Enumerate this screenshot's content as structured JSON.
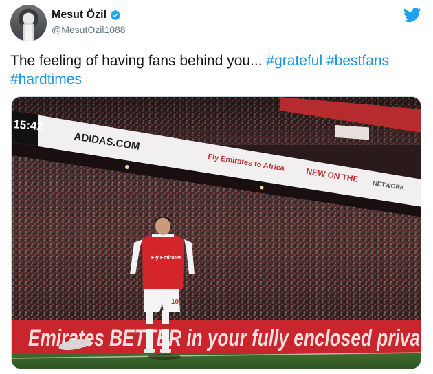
{
  "tweet": {
    "display_name": "Mesut Özil",
    "handle": "@MesutOzil1088",
    "text_main": "The feeling of having fans behind you... ",
    "hashtags": [
      "#grateful",
      "#bestfans",
      "#hardtimes"
    ]
  },
  "media": {
    "scoreboard_time": "15:42",
    "board_text_1": "ADIDAS.COM",
    "board_text_2": "Fly Emirates to Africa",
    "board_text_3": "NEW ON THE",
    "board_text_4": "NETWORK",
    "shirt_sponsor": "Fly Emirates",
    "shirt_number": "10",
    "perimeter_text": "Emirates  BETTER in your fully enclosed priva"
  },
  "icons": {
    "verified": "verified-badge-icon",
    "twitter": "twitter-bird-icon"
  },
  "colors": {
    "hashtag": "#1b95e0",
    "verified": "#1da1f2",
    "twitter": "#1da1f2",
    "handle": "#657786"
  }
}
